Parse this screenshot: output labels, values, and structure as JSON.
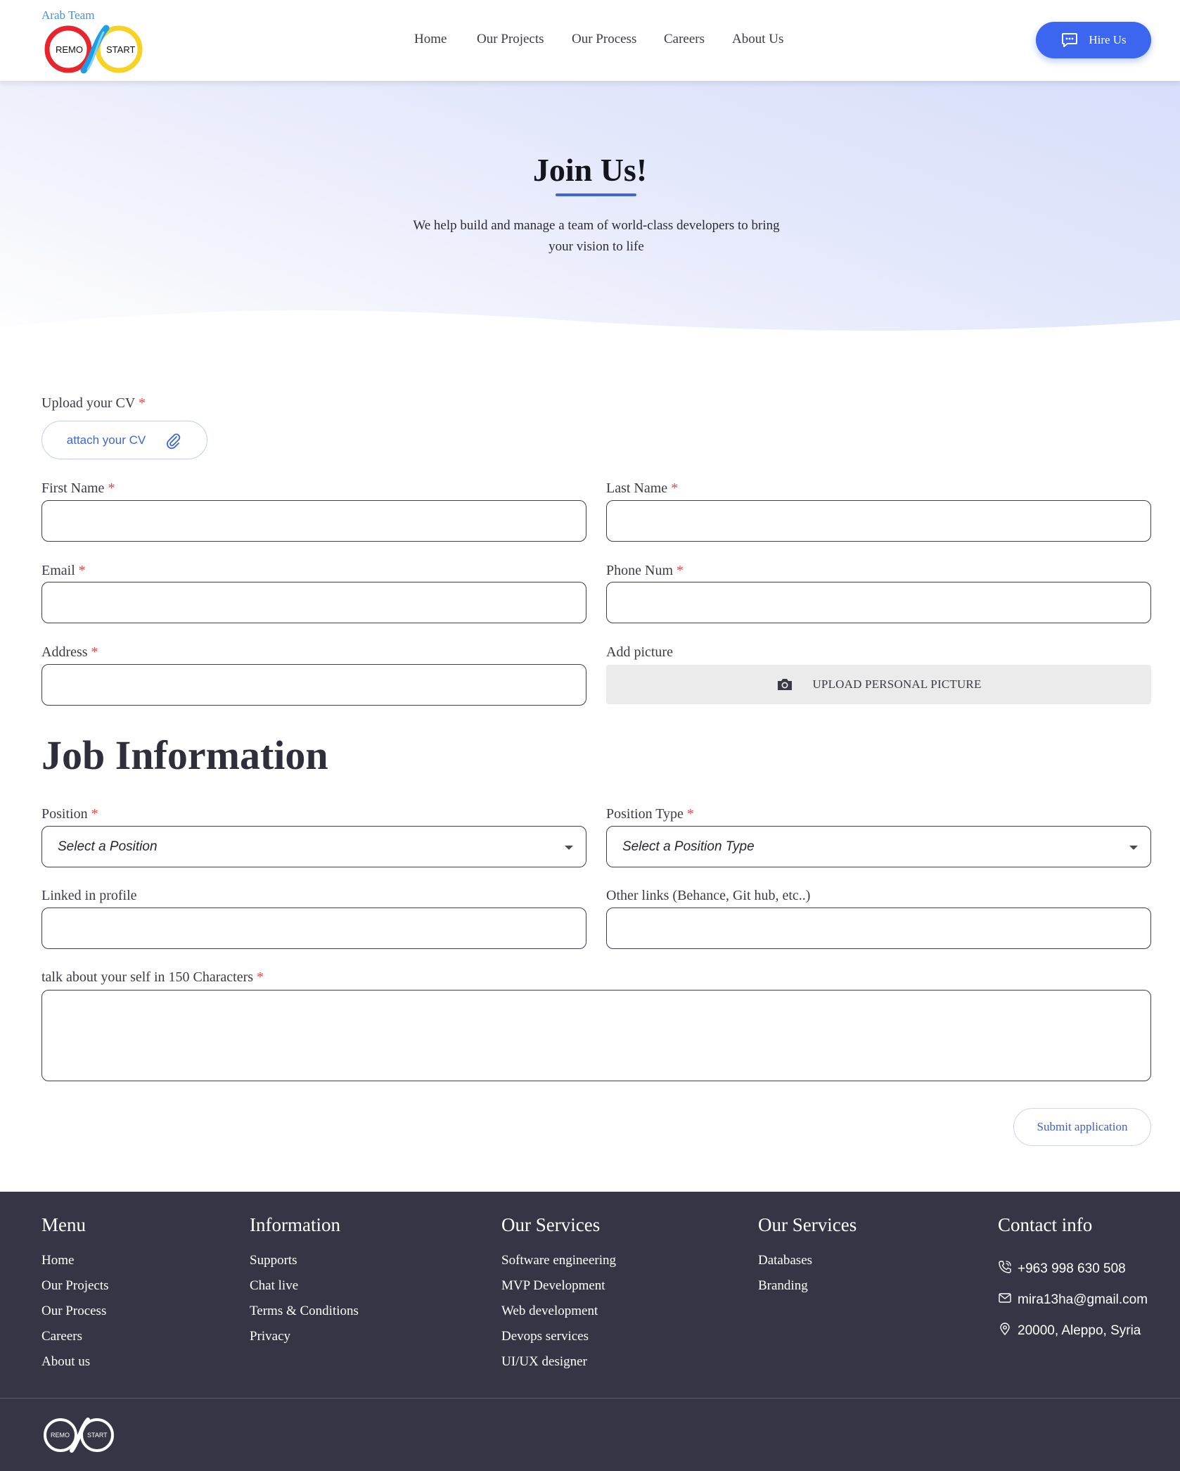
{
  "header": {
    "brand_team": "Arab Team",
    "logo_left": "REMO",
    "logo_right": "START",
    "nav": [
      "Home",
      "Our Projects",
      "Our Process",
      "Careers",
      "About Us"
    ],
    "hire_label": "Hire Us",
    "accent_color": "#3d66f0"
  },
  "hero": {
    "title": "Join Us!",
    "subtitle": "We help build and manage a team of world-class developers to bring your vision to life"
  },
  "form": {
    "cv_label": "Upload your CV",
    "cv_button": "attach your CV",
    "first_name_label": "First Name",
    "last_name_label": "Last Name",
    "email_label": "Email",
    "phone_label": "Phone Num",
    "address_label": "Address",
    "picture_label": "Add picture",
    "picture_button": "UPLOAD PERSONAL PICTURE",
    "required_mark": "*"
  },
  "job": {
    "title": "Job Information",
    "position_label": "Position",
    "position_value": "Select a Position",
    "position_type_label": "Position Type",
    "position_type_value": "Select a Position Type",
    "linkedin_label": "Linked in profile",
    "other_links_label": "Other links (Behance, Git hub, etc..)",
    "about_label": "talk about your self in 150 Characters",
    "submit_label": "Submit application"
  },
  "footer": {
    "menu_title": "Menu",
    "menu": [
      "Home",
      "Our Projects",
      "Our Process",
      "Careers",
      "About us"
    ],
    "info_title": "Information",
    "info": [
      "Supports",
      "Chat live",
      "Terms & Conditions",
      "Privacy"
    ],
    "services_title": "Our Services",
    "services": [
      "Software engineering",
      "MVP Development",
      "Web development",
      "Devops services",
      "UI/UX designer"
    ],
    "services2_title": "Our Services",
    "services2": [
      "Databases",
      "Branding"
    ],
    "contact_title": "Contact info",
    "phone": "+963 998 630 508",
    "email": "mira13ha@gmail.com",
    "address": "20000, Aleppo, Syria",
    "logo_left": "REMO",
    "logo_right": "START",
    "background_color": "#353545"
  }
}
